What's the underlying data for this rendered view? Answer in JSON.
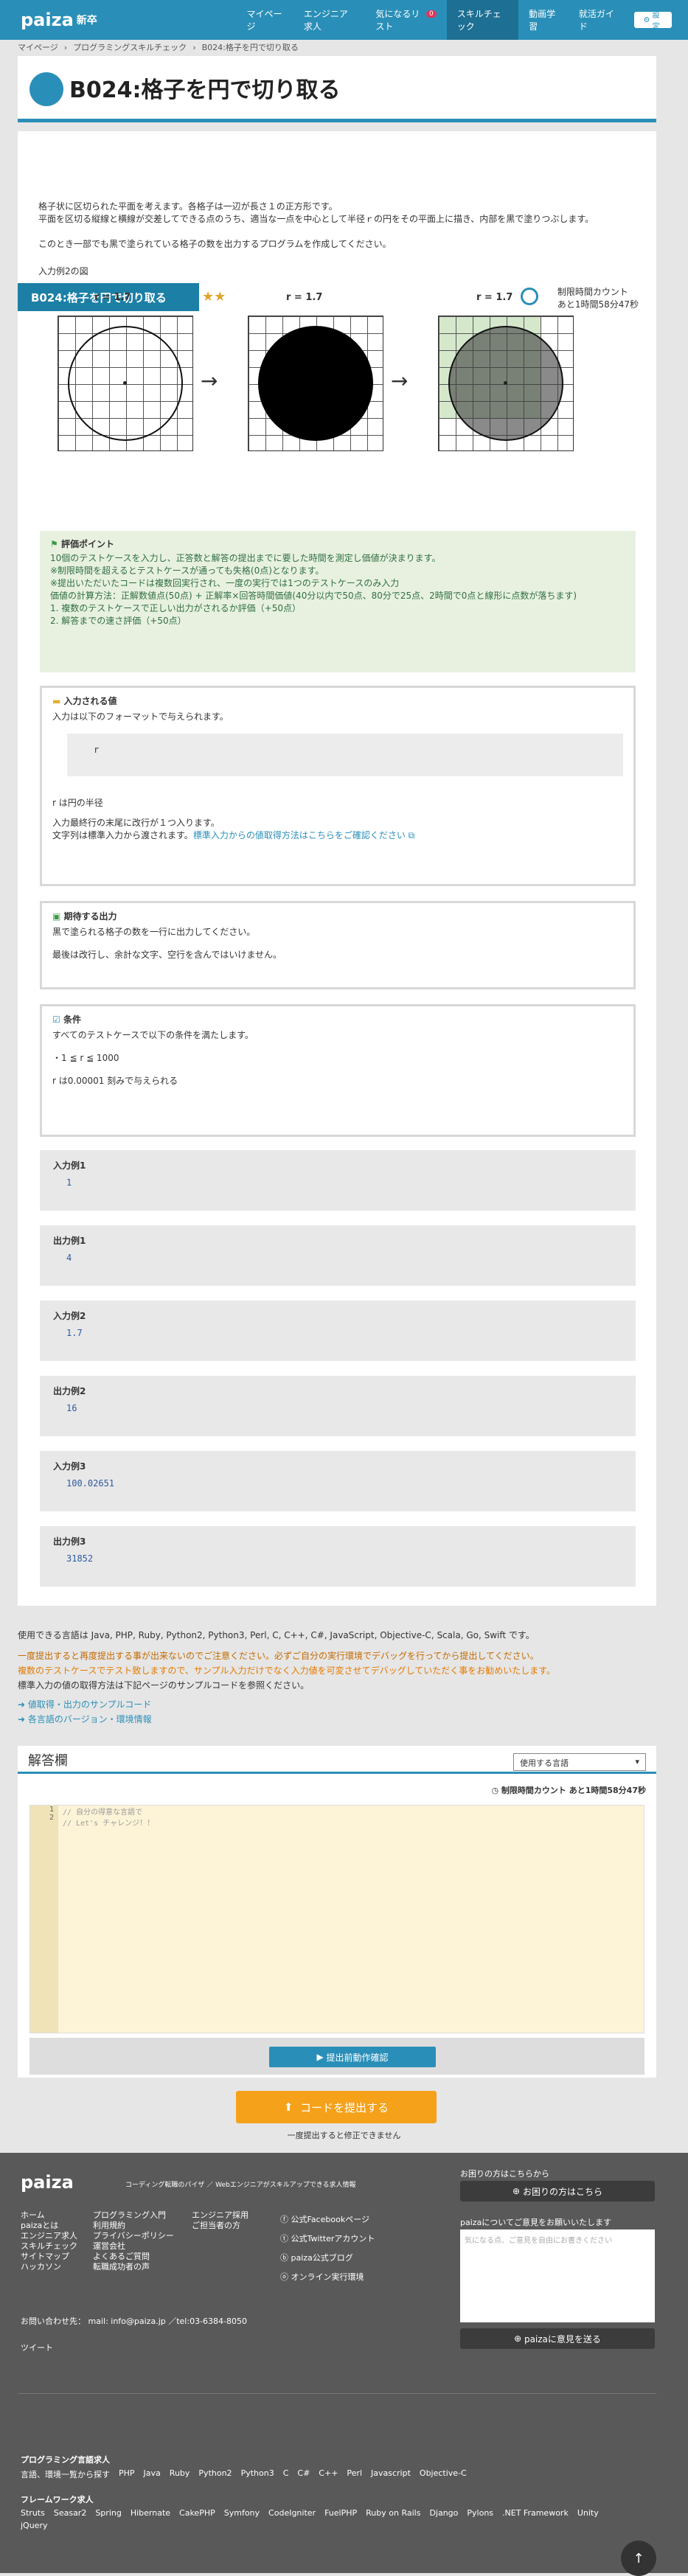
{
  "nav": {
    "logo": "paiza",
    "logo_sup": "新卒",
    "items": [
      "マイページ",
      "エンジニア求人",
      "気になるリスト",
      "スキルチェック",
      "動画学習",
      "就活ガイド"
    ],
    "badge": "0",
    "settings": "設定"
  },
  "breadcrumb": [
    "マイページ",
    "プログラミングスキルチェック",
    "B024:格子を円で切り取る"
  ],
  "page_title": "B024:格子を円で切り取る",
  "problem": {
    "tag": "B024:格子を円で切り取る",
    "stars": "★★",
    "timer_label": "制限時間カウント",
    "timer_value": "あと1時間58分47秒",
    "desc1": "格子状に区切られた平面を考えます。各格子は一辺が長さ１の正方形です。",
    "desc2": "平面を区切る縦線と横線が交差してできる点のうち、適当な一点を中心として半径ｒの円をその平面上に描き、内部を黒で塗りつぶします。",
    "desc3": "このとき一部でも黒で塗られている格子の数を出力するプログラムを作成してください。",
    "fig_caption": "入力例2の図",
    "fig_label": "r = 1.7"
  },
  "eval": {
    "title": "評価ポイント",
    "lines": [
      "10個のテストケースを入力し、正答数と解答の提出までに要した時間を測定し価値が決まります。",
      "※制限時間を超えるとテストケースが通っても失格(0点)となります。",
      "※提出いただいたコードは複数回実行され、一度の実行では1つのテストケースのみ入力",
      "価値の計算方法：正解数値点(50点) + 正解率×回答時間価値(40分以内で50点、80分で25点、2時間で0点と線形に点数が落ちます)",
      "1. 複数のテストケースで正しい出力がされるか評価（+50点）",
      "2. 解答までの速さ評価（+50点）"
    ]
  },
  "input": {
    "title": "入力される値",
    "lead": "入力は以下のフォーマットで与えられます。",
    "code": "r",
    "note1": "r は円の半径",
    "note2": "入力最終行の末尾に改行が１つ入ります。",
    "note3": "文字列は標準入力から渡されます。",
    "link": "標準入力からの値取得方法はこちらをご確認ください"
  },
  "output": {
    "title": "期待する出力",
    "l1": "黒で塗られる格子の数を一行に出力してください。",
    "l2": "最後は改行し、余計な文字、空行を含んではいけません。"
  },
  "cond": {
    "title": "条件",
    "l1": "すべてのテストケースで以下の条件を満たします。",
    "l2": "・1 ≦ r ≦ 1000",
    "l3": "r は0.00001 刻みで与えられる"
  },
  "samples": [
    {
      "title": "入力例1",
      "value": "1"
    },
    {
      "title": "出力例1",
      "value": "4"
    },
    {
      "title": "入力例2",
      "value": "1.7"
    },
    {
      "title": "出力例2",
      "value": "16"
    },
    {
      "title": "入力例3",
      "value": "100.02651"
    },
    {
      "title": "出力例3",
      "value": "31852"
    }
  ],
  "langs": {
    "l1": "使用できる言語は Java, PHP, Ruby, Python2, Python3, Perl, C, C++, C#, JavaScript, Objective-C, Scala, Go, Swift です。",
    "l2": "一度提出すると再度提出する事が出来ないのでご注意ください。必ずご自分の実行環境でデバッグを行ってから提出してください。",
    "l3": "複数のテストケースでテスト致しますので、サンプル入力だけでなく入力値を可変させてデバッグしていただく事をお勧めいたします。",
    "l4": "標準入力の値の取得方法は下記ページのサンプルコードを参照ください。",
    "link1": "値取得・出力のサンプルコード",
    "link2": "各言語のバージョン・環境情報"
  },
  "answer": {
    "title": "解答欄",
    "lang_placeholder": "使用する言語",
    "timer": "制限時間カウント あと1時間58分47秒",
    "line1": "// 自分の得意な言語で",
    "line2": "// Let's チャレンジ！！",
    "run": "提出前動作確認",
    "submit": "コードを提出する",
    "note": "一度提出すると修正できません"
  },
  "footer": {
    "logo": "paiza",
    "tagline": "コーディング転職のパイザ ／ Webエンジニアがスキルアップできる求人情報",
    "col1": [
      "ホーム",
      "paizaとは",
      "エンジニア求人",
      "スキルチェック",
      "サイトマップ",
      "ハッカソン"
    ],
    "col2": [
      "プログラミング入門",
      "利用規約",
      "プライバシーポリシー",
      "運営会社",
      "よくあるご質問",
      "転職成功者の声"
    ],
    "col3": [
      "エンジニア採用",
      "ご担当者の方"
    ],
    "social": [
      "公式Facebookページ",
      "公式Twitterアカウント",
      "paiza公式ブログ",
      "オンライン実行環境"
    ],
    "contact": "お問い合わせ先： mail: info@paiza.jp ／tel:03-6384-8050",
    "tweet": "ツイート",
    "help_lead": "お困りの方はこちらから",
    "help_btn": "お困りの方はこちら",
    "opinion_lead": "paizaについてご意見をお願いいたします",
    "opinion_ph": "気になる点、ご意見を自由にお書きください",
    "opinion_btn": "paizaに意見を送る",
    "prog_title": "プログラミング言語求人",
    "prog_items": [
      "言語、環境一覧から探す",
      "PHP",
      "Java",
      "Ruby",
      "Python2",
      "Python3",
      "C",
      "C#",
      "C++",
      "Perl",
      "Javascript",
      "Objective-C"
    ],
    "fw_title": "フレームワーク求人",
    "fw_items": [
      "Struts",
      "Seasar2",
      "Spring",
      "Hibernate",
      "CakePHP",
      "Symfony",
      "CodeIgniter",
      "FuelPHP",
      "Ruby on Rails",
      "Django",
      "Pylons",
      ".NET Framework",
      "Unity",
      "jQuery"
    ]
  },
  "colors": {
    "brand": "#2a8fb8",
    "accent": "#f5a11a"
  }
}
